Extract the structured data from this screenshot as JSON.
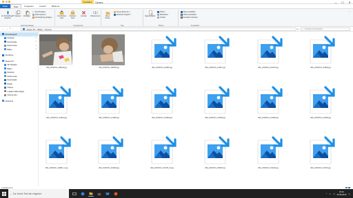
{
  "titlebar": {
    "context_tab": "Verwalten",
    "window_title": "Camera",
    "minimize": "—",
    "maximize": "☐",
    "close": "✕"
  },
  "ribbon_tabs": [
    "Datei",
    "Start",
    "Freigeben",
    "Ansicht",
    "Bildtools"
  ],
  "ribbon": {
    "clipboard": {
      "pin_label": "An Schnellzugriff anheften",
      "copy_label": "Kopieren",
      "paste_label": "Einfügen",
      "cut_label": "Ausschneiden",
      "copy_path_label": "Pfad kopieren",
      "paste_shortcut_label": "Verknüpfung einfügen",
      "group_label": "Zwischenablage"
    },
    "organize": {
      "move_label": "Verschieben nach",
      "copy_to_label": "Kopieren nach",
      "delete_label": "Löschen",
      "rename_label": "Umbenennen",
      "group_label": "Organisieren"
    },
    "new": {
      "new_folder_label": "Neuer Ordner",
      "new_item_label": "Neues Element",
      "easy_access_label": "Einfacher Zugriff",
      "group_label": "Neu"
    },
    "open": {
      "properties_label": "Eigenschaften",
      "open_label": "Öffnen",
      "edit_label": "Bearbeiten",
      "history_label": "Verlauf",
      "group_label": "Öffnen"
    },
    "select": {
      "select_all_label": "Alles auswählen",
      "select_none_label": "Nichts auswählen",
      "invert_label": "Auswahl umkehren",
      "group_label": "Auswählen"
    }
  },
  "address": {
    "path": [
      "Dieser PC",
      "Bilder",
      "Camera"
    ],
    "search_placeholder": "\"Camera\" durchsuchen"
  },
  "sidebar": {
    "items": [
      {
        "label": "Schnellzugriff",
        "icon": "star-icon",
        "color": "#1a6fc4",
        "pinned": false,
        "selected": true
      },
      {
        "label": "Desktop",
        "icon": "desktop-icon",
        "color": "#3a8ee6",
        "pinned": true
      },
      {
        "label": "Downloads",
        "icon": "download-icon",
        "color": "#1a6fc4",
        "pinned": true
      },
      {
        "label": "Dokumente",
        "icon": "documents-icon",
        "color": "#7a8ba0",
        "pinned": true
      },
      {
        "label": "Bilder",
        "icon": "pictures-icon",
        "color": "#3a8ee6",
        "pinned": true
      },
      {
        "label": "OneDrive",
        "icon": "cloud-icon",
        "color": "#1a6fc4",
        "gap": true
      },
      {
        "label": "Dieser PC",
        "icon": "pc-icon",
        "color": "#3a8ee6",
        "gap": true
      },
      {
        "label": "3D-Objekte",
        "icon": "cube-icon",
        "color": "#3a8ee6"
      },
      {
        "label": "Bilder",
        "icon": "pictures-icon",
        "color": "#3a8ee6"
      },
      {
        "label": "Desktop",
        "icon": "desktop-icon",
        "color": "#3a8ee6"
      },
      {
        "label": "Dokumente",
        "icon": "documents-icon",
        "color": "#7a8ba0"
      },
      {
        "label": "Downloads",
        "icon": "download-icon",
        "color": "#1a6fc4"
      },
      {
        "label": "Musik",
        "icon": "music-icon",
        "color": "#1a6fc4"
      },
      {
        "label": "Videos",
        "icon": "video-icon",
        "color": "#5a6b8c"
      },
      {
        "label": "Lokaler Datenträger",
        "icon": "drive-icon",
        "color": "#888888"
      },
      {
        "label": "Volume (E:)",
        "icon": "drive-icon",
        "color": "#888888"
      },
      {
        "label": "Netzwerk",
        "icon": "network-icon",
        "color": "#3a8ee6",
        "gap": true
      }
    ]
  },
  "files": [
    {
      "name": "IMG_20190721_085444.jpg",
      "type": "photo",
      "col": 0,
      "row": 0
    },
    {
      "name": "IMG_20190721_085455.jpg",
      "type": "photo",
      "col": 1,
      "row": 0
    },
    {
      "name": "IMG_20190721_110802.jpg",
      "type": "placeholder",
      "col": 2,
      "row": 0
    },
    {
      "name": "IMG_20190721_114817.jpg",
      "type": "placeholder",
      "col": 3,
      "row": 0
    },
    {
      "name": "IMG_20190721_115270.jpg",
      "type": "placeholder",
      "col": 4,
      "row": 0
    },
    {
      "name": "IMG_20190721_114802.jpg",
      "type": "placeholder",
      "col": 5,
      "row": 0
    },
    {
      "name": "IMG_20190721_114813.jpg",
      "type": "placeholder",
      "col": 0,
      "row": 1
    },
    {
      "name": "IMG_20190721_114825.jpg",
      "type": "placeholder",
      "col": 1,
      "row": 1
    },
    {
      "name": "IMG_20190721_101802.jpg",
      "type": "placeholder",
      "col": 2,
      "row": 1
    },
    {
      "name": "IMG_20190721_101803.jpg",
      "type": "placeholder",
      "col": 3,
      "row": 1
    },
    {
      "name": "IMG_20190721_101815.jpg",
      "type": "placeholder",
      "col": 4,
      "row": 1
    },
    {
      "name": "IMG_20190721_101820.jpg",
      "type": "placeholder",
      "col": 5,
      "row": 1
    },
    {
      "name": "IMG_20190721_160844_1.jpg",
      "type": "placeholder",
      "col": 0,
      "row": 2
    },
    {
      "name": "IMG_20190721_161822.jpg",
      "type": "placeholder",
      "col": 1,
      "row": 2
    },
    {
      "name": "IMG_20190721_161739_01.jpg",
      "type": "placeholder",
      "col": 2,
      "row": 2
    },
    {
      "name": "IMG_20190721_150807.jpg",
      "type": "placeholder",
      "col": 3,
      "row": 2
    },
    {
      "name": "IMG_20190721_151102.jpg",
      "type": "placeholder",
      "col": 4,
      "row": 2
    },
    {
      "name": "IMG_20190721_151115.jpg",
      "type": "placeholder",
      "col": 5,
      "row": 2
    }
  ],
  "status": {
    "count": "1.913 Elemente"
  },
  "taskbar": {
    "search_placeholder": "Zur Suche Text hier eingeben",
    "time": "10:01",
    "date": "16.08.2019"
  },
  "colors": {
    "accent": "#1a6fc4",
    "icon_light": "#3ea0ee",
    "arrow": "#1c8fe6"
  }
}
